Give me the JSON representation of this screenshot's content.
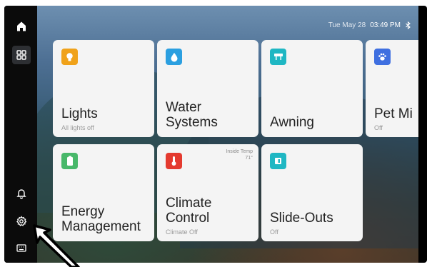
{
  "status": {
    "date": "Tue May 28",
    "time": "03:49 PM"
  },
  "sidebar": [
    "home",
    "dashboard",
    "alerts",
    "settings",
    "keyboard"
  ],
  "tiles": {
    "lights": {
      "title": "Lights",
      "sub": "All lights off",
      "color": "#f0a21a"
    },
    "water": {
      "title1": "Water",
      "title2": "Systems",
      "color": "#2b9fe0"
    },
    "awning": {
      "title": "Awning",
      "color": "#1fb7c3"
    },
    "pet": {
      "title": "Pet Mi",
      "sub": "Off",
      "color": "#3f6fe0"
    },
    "energy": {
      "title1": "Energy",
      "title2": "Management",
      "color": "#48b86a"
    },
    "climate": {
      "title1": "Climate",
      "title2": "Control",
      "sub": "Climate Off",
      "corner1": "Inside Temp",
      "corner2": "71°",
      "color": "#e43a2f"
    },
    "slideouts": {
      "title": "Slide-Outs",
      "sub": "Off",
      "color": "#1fb7c3"
    }
  }
}
